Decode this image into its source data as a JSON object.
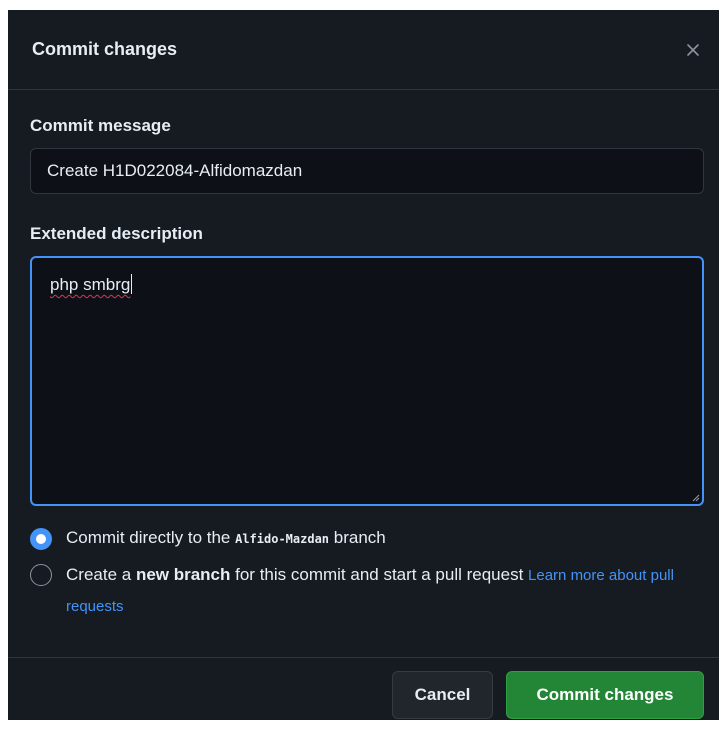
{
  "dialog": {
    "title": "Commit changes",
    "close_icon": "close-icon"
  },
  "commit_message": {
    "label": "Commit message",
    "value": "Create H1D022084-Alfidomazdan"
  },
  "extended_description": {
    "label": "Extended description",
    "value": "php smbrg"
  },
  "options": {
    "direct": {
      "selected": true,
      "prefix": "Commit directly to the ",
      "branch": "Alfido-Mazdan",
      "suffix": " branch"
    },
    "new_branch": {
      "selected": false,
      "prefix": "Create a ",
      "bold": "new branch",
      "suffix": " for this commit and start a pull request ",
      "link": "Learn more about pull requests"
    }
  },
  "footer": {
    "cancel_label": "Cancel",
    "commit_label": "Commit changes"
  },
  "colors": {
    "background": "#161b22",
    "input_background": "#0d1117",
    "accent": "#4493f8",
    "primary_button": "#238636"
  }
}
